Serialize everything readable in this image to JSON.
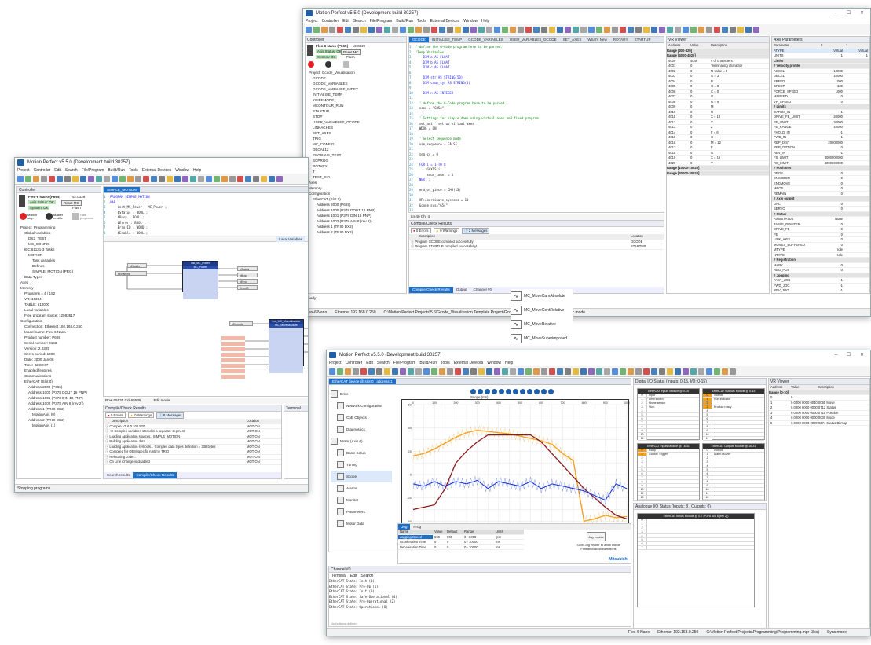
{
  "colors": {
    "accent": "#1e6fc8",
    "block_header": "#1f3c88",
    "plot_blue": "#1030d0",
    "plot_orange": "#f0a020",
    "plot_darkred": "#8b1a1a"
  },
  "w1": {
    "title": "Motion Perfect v5.5.0 (Development build 30257)",
    "menu": [
      "Project",
      "Controller",
      "Edit",
      "Search",
      "File/Program",
      "Build/Run",
      "Tools",
      "External Devices",
      "Window",
      "Help"
    ],
    "controller_panel": "Controller",
    "device": "Flex-6 Nano (P665)",
    "device_ver": "v2.0329",
    "axis_status": "Axis Status: OK",
    "reset_mc": "Reset MC",
    "system_status": "System: OK",
    "flash": "Flash",
    "btn_motion_stop": "Motion stop",
    "btn_master_enable": "Master enable",
    "btn_halt": "Halt programs",
    "tree": [
      "Project: Programming",
      "Global Variables",
      "DX2_TEST",
      "MC_CONFIG",
      "IEC 61131-3 Tasks",
      "MOTION",
      "Task variables",
      "Defines",
      "SIMPLE_MOTION (PRG)",
      "Data Types",
      "Axes",
      "Memory",
      "Programs = 4 / 192",
      "VR: 16384",
      "TABLE: 512000",
      "Local variables",
      "Free program space: 12983517",
      "Configuration",
      "Connection: Ethernet 192.168.0.250",
      "Model name: Flex-6 Nano",
      "Product number: P669",
      "Serial number: 3158",
      "Version: 2.0329",
      "Servo period: 1000",
      "Date: 2000 Jan 06",
      "Time: 02:00:07",
      "Enabled features",
      "Communications",
      "EtherCAT (Slot 0)",
      "Address 2000 (P665)",
      "Address 1000 (P378 DOUT 16 PNP)",
      "Address 1001 (P378 DIN 16 PNP)",
      "Address 1002 (P378 AIN 8 (rev 2))",
      "Address 1 (TRIO DX2)",
      "MotionAxis (0)",
      "Address 2 (TRIO DX2)",
      "MotionAxis (1)"
    ],
    "editor_tab": "SIMPLE_MOTION",
    "code": [
      "PROGRAM SIMPLE_MOTION",
      "VAR",
      "    inst_MC_Power : MC_Power ;",
      "    bStatus : BOOL ;",
      "    bBusy : BOOL ;",
      "    bError : BOOL ;",
      "    ErrorID : WORD ;",
      "    bEnable : BOOL ;"
    ],
    "local_vars": "Local Variables",
    "fb1": {
      "type": "inst_MC_Power",
      "name": "MC_Power"
    },
    "fb2": {
      "type": "inst_MC_MoveAbsolute",
      "name": "MC_MoveAbsolute"
    },
    "row_col": "Row 65535  Col 65535",
    "edit_mode": "Edit mode",
    "results_title": "Compile/Check Results",
    "counts": {
      "errors": "0 Errors",
      "warnings": "0 Warnings",
      "messages": "8 Messages"
    },
    "col_desc": "Description",
    "col_loc": "Location",
    "messages": [
      {
        "d": "Compile V1.6.0.100.520",
        "l": "MOTION"
      },
      {
        "d": "<< Complex variables stored in a separate segment",
        "l": "MOTION"
      },
      {
        "d": "Loading application sources.. SIMPLE_MOTION",
        "l": "MOTION"
      },
      {
        "d": "Building application data...",
        "l": "MOTION"
      },
      {
        "d": "Loading application symbols... Complex data types definition = 338 bytes",
        "l": "MOTION"
      },
      {
        "d": "Compiled for OEM specific runtime TRIO",
        "l": "MOTION"
      },
      {
        "d": "Relocating code...",
        "l": "MOTION"
      },
      {
        "d": "On Line Change is disabled",
        "l": "MOTION"
      }
    ],
    "bottom_tabs": [
      "Search results",
      "Compile/Check Results"
    ],
    "terminal": "Terminal",
    "status": "Stopping programs"
  },
  "w2": {
    "title": "Motion Perfect v5.5.0 (Development build 30257)",
    "menu": [
      "Project",
      "Controller",
      "Edit",
      "Search",
      "File/Program",
      "Build/Run",
      "Tools",
      "External Devices",
      "Window",
      "Help"
    ],
    "update": "Update available",
    "controller_panel": "Controller",
    "device": "Flex-6 Nano (P665)",
    "device_ver": "v2.0329",
    "axis_status": "Axis Status: OK",
    "reset_mc": "Reset MC",
    "system_status": "System: OK",
    "flash": "Flash",
    "tree": [
      "Project: Gcode_Visualisation",
      "GCODE",
      "GCODE_VARIABLES",
      "GCODE_VARIABLE_INDEX",
      "INITIALISE_TEMP",
      "KNIFEMODE",
      "MCONTOUR_RUN",
      "STARTUP",
      "STOP",
      "USER_VARIABLES_GCODE",
      "LINKACHES",
      "SET_AXES",
      "TRIG",
      "MC_CONFIG",
      "DECAL12",
      "ENGRAVE_TEST",
      "SCPROG",
      "ROTARY",
      "T",
      "TEST_SID",
      "Axes",
      "Memory",
      "Configuration",
      "EtherCAT (Slot 0)",
      "Address 2000 (P665)",
      "Address 1000 (P378 DOUT 16 PNP)",
      "Address 1001 (P378 DIN 16 PNP)",
      "Address 1002 (P378 AIN 8 (rev 2))",
      "Address 1 (TRIO DX2)",
      "Address 2 (TRIO DX2)"
    ],
    "editor_tabs": [
      "GCODE",
      "INITIALISE_TEMP",
      "GCODE_VARIABLES",
      "USER_VARIABLES_GCODE",
      "SET_AXES",
      "What's New",
      "ROTARY",
      "STARTUP"
    ],
    "code": [
      "' define the G-Code program here to be parsed.",
      "'Temp Variables",
      "    DIM a AS FLOAT",
      "    DIM b AS FLOAT",
      "    DIM c AS FLOAT",
      "",
      "    DIM str AS STRING(50)",
      "    DIM cnum_sys AS STRING(4)",
      "",
      "    DIM n AS INTEGER",
      "",
      "  ' define the G-Code program here to be parsed.",
      "  scon = \"G054\"",
      "",
      "  ' Settings for simple demo using virtual axes and fixed program",
      "  set_axi ' set up virtual axes",
      "  WDOG = ON",
      "",
      "  ' Select sequence mode",
      "  use_sequence = FALSE",
      "",
      "  seq_cs = 0",
      "",
      "  FOR i = 1 TO 8",
      "      GAXIS(i)",
      "      sour_count = 1",
      "  NEXT i",
      "",
      "  end_of_piece = CHR(13)",
      "",
      "  VR:coordinate_systems = 10",
      "  Gcode_sys=\"G54\"",
      "",
      "  'Initialise VR variables for use in the program",
      "  GCODE scon_num_cs",
      "  GCODE scon_num_frame",
      "",
      "  'Program visualise mode",
      "  VR:program_mode.program_point = OFF",
      "  VR:program_mode.program_pause = OFF   ' not used in this version"
    ],
    "pos": "Ln  40   Chr  4",
    "results_title": "Compile/Check Results",
    "counts": {
      "errors": "0 Errors",
      "warnings": "0 Warnings",
      "messages": "2 Messages"
    },
    "col_desc": "Description",
    "col_loc": "Location",
    "messages": [
      {
        "d": "Program GCODE compiled successfully!",
        "l": "GCODE"
      },
      {
        "d": "Program STARTUP compiled successfully!",
        "l": "STARTUP"
      }
    ],
    "bottom_tabs": [
      "Compile/Check Results",
      "Output",
      "Channel #0"
    ],
    "vr_title": "VR Viewer",
    "vr_cols": [
      "Address",
      "Value",
      "Description"
    ],
    "vr_range1": "Range [300-320]",
    "vr_range2": "Range [4000-4020]",
    "vr_rows": [
      [
        "4000",
        "4046",
        "# of characters"
      ],
      [
        "4001",
        "0",
        "Terminating character"
      ],
      [
        "4002",
        "0",
        "N value = 0"
      ],
      [
        "4003",
        "0",
        "G = 2"
      ],
      [
        "4004",
        "0",
        "B"
      ],
      [
        "4005",
        "0",
        "G = 8"
      ],
      [
        "4006",
        "0",
        "C = 0"
      ],
      [
        "4007",
        "0",
        "G"
      ],
      [
        "4008",
        "0",
        "G = 6"
      ],
      [
        "4009",
        "0",
        "M"
      ],
      [
        "4010",
        "0",
        "R"
      ],
      [
        "4011",
        "0",
        "X = 10"
      ],
      [
        "4012",
        "0",
        "Y"
      ],
      [
        "4013",
        "0",
        "Z"
      ],
      [
        "4014",
        "0",
        "F = 6"
      ],
      [
        "4015",
        "0",
        "G"
      ],
      [
        "4016",
        "0",
        "M = 12"
      ],
      [
        "4017",
        "0",
        "F"
      ],
      [
        "4018",
        "0",
        "G"
      ],
      [
        "4019",
        "0",
        "X = 15"
      ],
      [
        "4020",
        "0",
        "Y"
      ]
    ],
    "vr_range3": "Range [10000-10020]",
    "vr_range4": "Range [30000-30020]",
    "axis_title": "Axis Parameters",
    "axis_cols": [
      "Parameter",
      "0",
      "1"
    ],
    "axis_rows": [
      [
        "ATYPE",
        "Virtual",
        "Virtual",
        "s"
      ],
      [
        "UNITS",
        "1",
        "1",
        "r"
      ],
      [
        "Limits",
        "",
        "",
        "h"
      ],
      [
        "# Velocity profile",
        "",
        "",
        "h"
      ],
      [
        "ACCEL",
        "10000",
        "",
        "r"
      ],
      [
        "DECEL",
        "10000",
        "",
        "r"
      ],
      [
        "SPEED",
        "1000",
        "",
        "r"
      ],
      [
        "CREEP",
        "100",
        "",
        "r"
      ],
      [
        "FORCE_SPEED",
        "1000",
        "",
        "r"
      ],
      [
        "MSPEED",
        "0",
        "",
        "r"
      ],
      [
        "VP_SPEED",
        "0",
        "",
        "r"
      ],
      [
        "# Limits",
        "",
        "",
        "h"
      ],
      [
        "DATUM_IN",
        "-1",
        "",
        "r"
      ],
      [
        "DRIVE_FE_LIMIT",
        "20000",
        "",
        "r"
      ],
      [
        "FE_LIMIT",
        "20000",
        "",
        "r"
      ],
      [
        "FE_RANGE",
        "10000",
        "",
        "r"
      ],
      [
        "FHOLD_IN",
        "-1",
        "",
        "r"
      ],
      [
        "FWD_IN",
        "-1",
        "",
        "r"
      ],
      [
        "REP_DIST",
        "20000000",
        "",
        "r"
      ],
      [
        "REP_OPTION",
        "0",
        "",
        "r"
      ],
      [
        "REV_IN",
        "-1",
        "",
        "r"
      ],
      [
        "FS_LIMIT",
        "4000000000",
        "",
        "r"
      ],
      [
        "RS_LIMIT",
        "-4000000000",
        "",
        "r"
      ],
      [
        "# Positions",
        "",
        "",
        "h"
      ],
      [
        "DPOS",
        "0",
        "",
        "r"
      ],
      [
        "ENCODER",
        "0",
        "",
        "r"
      ],
      [
        "ENDMOVE",
        "0",
        "",
        "r"
      ],
      [
        "MPOS",
        "0",
        "",
        "r"
      ],
      [
        "REMAIN",
        "0",
        "",
        "r"
      ],
      [
        "# Axis output",
        "",
        "",
        "h"
      ],
      [
        "DAC",
        "0",
        "",
        "r"
      ],
      [
        "SERVO",
        "0",
        "",
        "r"
      ],
      [
        "# Status",
        "",
        "",
        "h"
      ],
      [
        "AXISSTATUS",
        "None",
        "",
        "r"
      ],
      [
        "TABLE_POINTER",
        "0",
        "",
        "r"
      ],
      [
        "DRIVE_FE",
        "0",
        "",
        "r"
      ],
      [
        "FE",
        "0",
        "",
        "r"
      ],
      [
        "LINK_AXIS",
        "0",
        "",
        "r"
      ],
      [
        "MOVES_BUFFERED",
        "0",
        "",
        "r"
      ],
      [
        "MTYPE",
        "Idle",
        "",
        "r"
      ],
      [
        "NTYPE",
        "Idle",
        "",
        "r"
      ],
      [
        "# Registration",
        "",
        "",
        "h"
      ],
      [
        "MARK",
        "0",
        "",
        "r"
      ],
      [
        "REG_POS",
        "0",
        "",
        "r"
      ],
      [
        "# Jogging",
        "",
        "",
        "h"
      ],
      [
        "FAST_JOG",
        "-1",
        "",
        "r"
      ],
      [
        "FWD_JOG",
        "-1",
        "",
        "r"
      ],
      [
        "REV_JOG",
        "-1",
        "",
        "r"
      ]
    ],
    "status": "Ready",
    "footer": [
      "Flex-6 Nano",
      "Ethernet 192.168.0.250",
      "C:\\Motion Perfect Projects\\5.6\\Gcode_Visualisation Template Project\\Gcode_Visualisation.mpr (5pc)",
      "Sync mode"
    ]
  },
  "w3": {
    "title": "Motion Perfect v5.5.0 (Development build 30257)",
    "menu": [
      "Project",
      "Controller",
      "Edit",
      "Search",
      "File/Program",
      "Build/Run",
      "Tools",
      "External Devices",
      "Window",
      "Help"
    ],
    "update": "Update available",
    "ethercat_tab": "EtherCAT device @ slot 0_ address 1",
    "nav": [
      "Drive",
      "Network Configuration",
      "CoE Objects",
      "Diagnostics",
      "Motor (Axis 0)",
      "Basic Setup",
      "Tuning",
      "Scope",
      "Alarms",
      "Monitor",
      "Parameters",
      "Motor Data"
    ],
    "scope_label": "Scope (ms)",
    "mc_items": [
      "MC_MoveCamAbsolute",
      "MC_MoveContRelative",
      "MC_MoveRelative",
      "MC_MoveSuperimposed"
    ],
    "jog_tabs": [
      "Jog",
      "Prog"
    ],
    "jog_cols": [
      "Name",
      "Value",
      "Default",
      "Range",
      "Units"
    ],
    "jog_rows": [
      [
        "Jogging Speed",
        "500",
        "500",
        "0 - 6000",
        "rpm"
      ],
      [
        "Acceleration Time",
        "0",
        "0",
        "0 - 10000",
        "ms"
      ],
      [
        "Deceleration Time",
        "0",
        "0",
        "0 - 10000",
        "ms"
      ]
    ],
    "jog_hint": "Click 'Jog enable' to allow use of Forward/Backward buttons",
    "jog_btn": "Jog enable",
    "brand": "Mitsubishi",
    "chan_title": "Channel #0",
    "chan_menu": [
      "Terminal",
      "Edit",
      "Search"
    ],
    "chan_lines": [
      "EtherCAT State: Init (0)",
      "EtherCAT State: Pre-Op (1)",
      "EtherCAT State: Init (0)",
      "EtherCAT State: Safe-Operational (4)",
      "EtherCAT State: Pre-Operational (2)",
      "EtherCAT State: Operational (8)"
    ],
    "no_btn": "No buttons defined",
    "dig_title": "Digital I/O Status (Inputs: 0-15, I/O: 0-15)",
    "io_blocks": [
      {
        "t": "EtherCAT Inputs Module @ 0-15",
        "d": [
          "Input",
          "Limit switch",
          "Home sensor",
          "Stop"
        ]
      },
      {
        "t": "EtherCAT Outputs Module @ 0-15",
        "d": [
          "Output",
          "Run indicator",
          "",
          "Product ready"
        ]
      },
      {
        "t": "EtherCAT Inputs Module @ 16-31",
        "d": [
          "Estop",
          "Guard / Trigger"
        ]
      },
      {
        "t": "EtherCAT Outputs Module @ 16-31",
        "d": [
          "Output",
          "Alarm buzzer"
        ]
      }
    ],
    "ana_title": "Analogue I/O Status (Inputs: 8 , Outputs: 0)",
    "ana_block": "EtherCAT Inputs Module @ 0-7 (P378 AIN 8 (rev 2))",
    "vr_title": "VR Viewer",
    "vr_cols": [
      "Address",
      "Value",
      "Description"
    ],
    "vr_range": "Range [0-10]",
    "vr_rows": [
      [
        "0",
        "0"
      ],
      [
        "1",
        "0.0000 0000 0040 0065 Move"
      ],
      [
        "2",
        "0.0000 0000 0000 0712 Status"
      ],
      [
        "3",
        "0.0000 0000 0000 0715 Position"
      ],
      [
        "4",
        "0.0000 0000 0000 0000 Mode"
      ],
      [
        "5",
        "0.0000 0000 0000 0274 Status Bitmap"
      ]
    ],
    "status": "Operation successful (0000:0H4420)",
    "footer": [
      "Flex-6 Nano",
      "Ethernet 192.168.0.250",
      "C:\\Motion Perfect Projects\\Programming\\Programming.mpr (3pc)",
      "Sync mode"
    ]
  },
  "chart_data": {
    "type": "line",
    "x": [
      0,
      50,
      100,
      150,
      200,
      250,
      300,
      350,
      400,
      450,
      500,
      550,
      600,
      650,
      700,
      750,
      800,
      850,
      900,
      950,
      1000
    ],
    "xlim": [
      0,
      1000
    ],
    "ylim": [
      -60,
      60
    ],
    "series": [
      {
        "values": [
          16,
          18,
          22,
          27,
          32,
          36,
          38,
          37,
          36,
          35,
          33,
          31,
          29,
          26,
          18,
          12,
          -40,
          -38,
          -35,
          -37,
          -36
        ]
      },
      {
        "values": [
          -30,
          -28,
          -26,
          -12,
          10,
          20,
          28,
          34,
          34,
          34,
          34,
          34,
          28,
          18,
          8,
          -2,
          -12,
          -20,
          -28,
          -35,
          -38
        ]
      },
      {
        "values": [
          -8,
          -10,
          -6,
          -10,
          -6,
          -8,
          -5,
          -12,
          -6,
          -8,
          -10,
          -6,
          -12,
          -8,
          -10,
          -12,
          -14,
          -18,
          -22,
          -8,
          -12
        ]
      }
    ]
  }
}
